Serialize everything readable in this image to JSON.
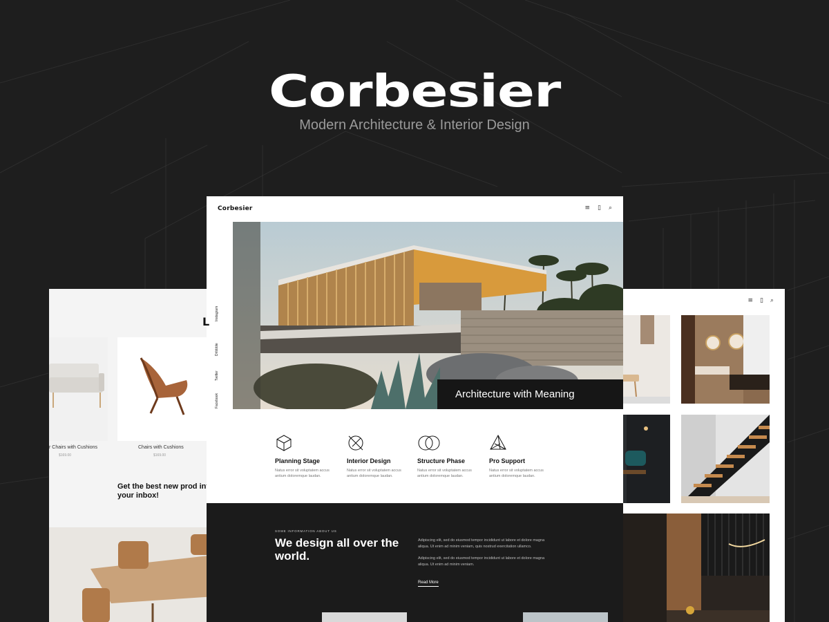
{
  "hero": {
    "brand": "Corbesier",
    "tagline": "Modern Architecture & Interior Design"
  },
  "main_panel": {
    "logo": "Corbesier",
    "nav_icons": [
      "menu-icon",
      "bag-icon",
      "search-icon"
    ],
    "social_links": [
      "Instagram",
      "Dribbble",
      "Twitter",
      "Facebook"
    ],
    "hero_caption": "Architecture with Meaning",
    "services": [
      {
        "icon": "hexagon-cube-icon",
        "title": "Planning Stage",
        "text": "Natus error sit voluptatem accus antium doloremque laudan."
      },
      {
        "icon": "circle-slash-icon",
        "title": "Interior Design",
        "text": "Natus error sit voluptatem accus antium doloremque laudan."
      },
      {
        "icon": "rings-icon",
        "title": "Structure Phase",
        "text": "Natus error sit voluptatem accus antium doloremque laudan."
      },
      {
        "icon": "prism-icon",
        "title": "Pro Support",
        "text": "Natus error sit voluptatem accus antium doloremque laudan."
      }
    ],
    "about": {
      "eyebrow": "SOME INFORMATION ABOUT US",
      "headline": "We design all over the world.",
      "paragraph_1": "Adipiscing elit, sed do eiusmod tempor incididunt ut labore et dolore magna aliqua. Ut enim ad minim veniam, quis nostrud exercitation ullamco.",
      "paragraph_2": "Adipiscing elit, sed do eiusmod tempor incididunt ut labore et dolore magna aliqua. Ut enim ad minim veniam.",
      "read_more": "Read More"
    }
  },
  "left_panel": {
    "heading_fragment": "L",
    "products": [
      {
        "name": "r Chairs with Cushions",
        "price": "$169.00"
      },
      {
        "name": "Chairs with Cushions",
        "price": "$169.00"
      }
    ],
    "newsletter": "Get the best new prod into your inbox!"
  },
  "right_panel": {
    "nav_icons": [
      "menu-icon",
      "bag-icon",
      "search-icon"
    ]
  }
}
